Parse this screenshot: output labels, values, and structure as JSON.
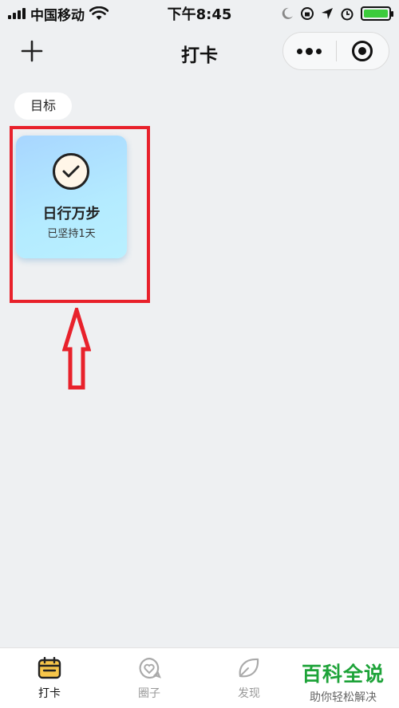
{
  "status_bar": {
    "carrier": "中国移动",
    "time": "下午8:45"
  },
  "nav": {
    "title": "打卡"
  },
  "category": {
    "label": "目标"
  },
  "habit_card": {
    "title": "日行万步",
    "subtitle": "已坚持1天"
  },
  "tabbar": {
    "items": [
      {
        "label": "打卡",
        "icon": "calendar-icon",
        "active": true
      },
      {
        "label": "圈子",
        "icon": "heart-bubble-icon",
        "active": false
      },
      {
        "label": "发现",
        "icon": "leaf-icon",
        "active": false
      }
    ]
  },
  "watermark": {
    "title": "百科全说",
    "subtitle": "助你轻松解决"
  },
  "colors": {
    "highlight": "#e8212b",
    "card_gradient_start": "#a8d6ff",
    "card_gradient_end": "#b9f0ff",
    "battery": "#3ccb3c",
    "watermark": "#1ea339"
  }
}
